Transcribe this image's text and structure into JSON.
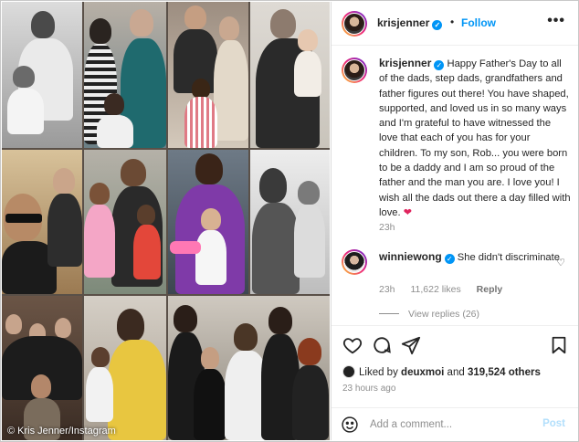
{
  "collage": {
    "credit": "© Kris Jenner/Instagram"
  },
  "post": {
    "username": "krisjenner",
    "follow_label": "Follow",
    "separator": "•",
    "more_label": "•••"
  },
  "caption": {
    "username": "krisjenner",
    "text": "Happy Father's Day to all of the dads, step dads, grandfathers and father figures out there! You have shaped, supported, and loved us in so many ways and I'm grateful to have witnessed the love that each of you has for your children. To my son, Rob... you were born to be a daddy and I am so proud of the father and the man you are. I love you! I wish all the dads out there a day filled with love.",
    "emoji": "❤",
    "time": "23h"
  },
  "comment": {
    "username": "winniewong",
    "text": "She didn't discriminate",
    "time": "23h",
    "likes": "11,622 likes",
    "reply_label": "Reply",
    "view_replies": "View replies (26)"
  },
  "actions": {
    "liked_by_prefix": "Liked by",
    "liked_by_user": "deuxmoi",
    "liked_by_and": "and",
    "liked_by_count": "319,524 others",
    "timestamp": "23 hours ago"
  },
  "comment_bar": {
    "placeholder": "Add a comment...",
    "post_label": "Post"
  },
  "colors": {
    "link_blue": "#0095f6",
    "verified_blue": "#0095f6",
    "muted_text": "#8e8e8e"
  }
}
